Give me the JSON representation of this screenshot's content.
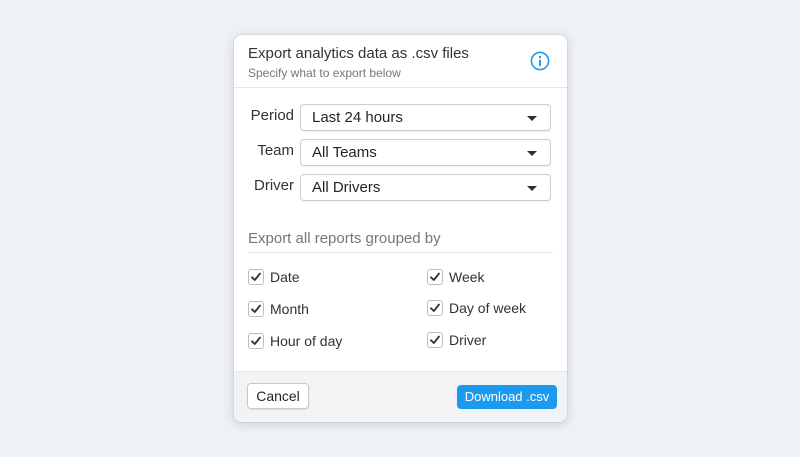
{
  "dialog": {
    "title": "Export analytics data as .csv files",
    "subtitle": "Specify what to export below",
    "info_icon": "info-icon"
  },
  "filters": [
    {
      "label": "Period",
      "value": "Last 24 hours"
    },
    {
      "label": "Team",
      "value": "All Teams"
    },
    {
      "label": "Driver",
      "value": "All Drivers"
    }
  ],
  "grouping": {
    "title": "Export all reports grouped by",
    "options": [
      {
        "label": "Date",
        "checked": true
      },
      {
        "label": "Week",
        "checked": true
      },
      {
        "label": "Month",
        "checked": true
      },
      {
        "label": "Day of week",
        "checked": true
      },
      {
        "label": "Hour of day",
        "checked": true
      },
      {
        "label": "Driver",
        "checked": true
      }
    ]
  },
  "footer": {
    "cancel_label": "Cancel",
    "download_label": "Download .csv"
  },
  "colors": {
    "accent": "#1b9af0",
    "background": "#eef1f5"
  }
}
